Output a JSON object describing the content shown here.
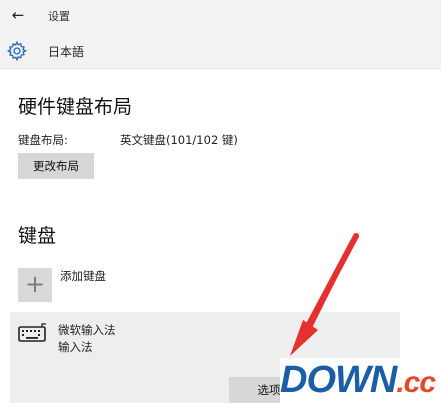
{
  "window": {
    "back_icon": "back-arrow-icon",
    "title": "设置"
  },
  "header": {
    "icon": "gear-icon",
    "title": "日本語"
  },
  "hardware_layout": {
    "title": "硬件键盘布局",
    "layout_label": "键盘布局:",
    "layout_value": "英文键盘(101/102 键)",
    "change_button": "更改布局"
  },
  "keyboards": {
    "title": "键盘",
    "add_icon": "plus-icon",
    "add_label": "添加键盘",
    "items": [
      {
        "icon": "keyboard-icon",
        "name": "微软输入法",
        "subtitle": "输入法",
        "options_button": "选项"
      }
    ]
  },
  "watermark": {
    "text_main": "DOWN",
    "text_suffix": ".cc",
    "colors": {
      "main": "#1a5ea8",
      "suffix": "#e8482a"
    }
  },
  "colors": {
    "chrome_bg": "#f2f2f2",
    "button_bg": "#d7d7d7",
    "annotation_arrow": "#e53030"
  }
}
